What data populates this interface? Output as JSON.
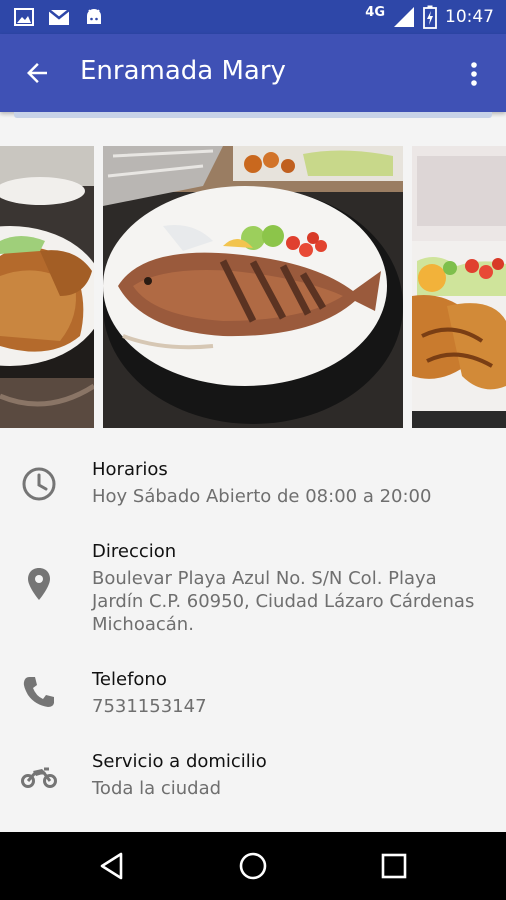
{
  "status_bar": {
    "network": "4G",
    "time": "10:47",
    "icons": [
      "image-icon",
      "gmail-icon",
      "android-icon",
      "signal-icon",
      "battery-icon"
    ]
  },
  "app_bar": {
    "title": "Enramada Mary",
    "icons": [
      "back-arrow-icon",
      "more-vert-icon"
    ]
  },
  "gallery": {
    "photos": [
      "photo-fried-fish-side",
      "photo-fried-fish-plate",
      "photo-shrimp-takeout"
    ]
  },
  "details": {
    "hours": {
      "title": "Horarios",
      "value": "Hoy Sábado Abierto de 08:00 a 20:00",
      "icon": "clock-icon"
    },
    "address": {
      "title": "Direccion",
      "value": "Boulevar Playa Azul No. S/N Col. Playa Jardín C.P. 60950, Ciudad Lázaro Cárdenas Michoacán.",
      "icon": "location-pin-icon"
    },
    "phone": {
      "title": "Telefono",
      "value": "7531153147",
      "icon": "phone-icon"
    },
    "delivery": {
      "title": "Servicio a domicilio",
      "value": "Toda la ciudad",
      "icon": "motorcycle-icon"
    }
  },
  "colors": {
    "status_bar": "#2e47a8",
    "app_bar": "#3f51b5",
    "background": "#f4f4f4",
    "icon_gray": "#757575"
  },
  "nav_bar": {
    "icons": [
      "back-triangle-icon",
      "home-circle-icon",
      "recents-square-icon"
    ]
  }
}
